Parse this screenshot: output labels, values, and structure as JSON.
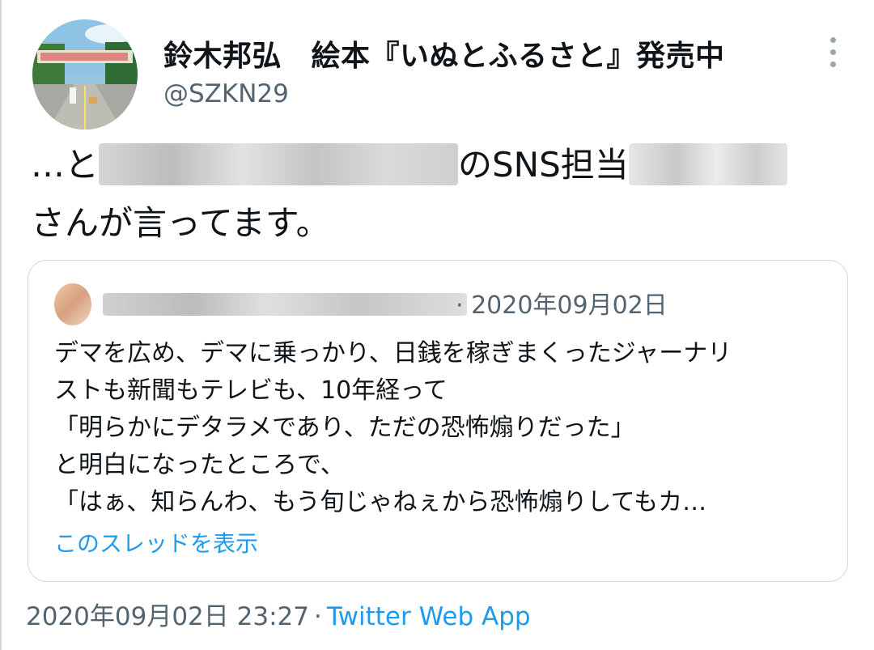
{
  "author": {
    "display_name": "鈴木邦弘　絵本『いぬとふるさと』発売中",
    "handle": "@SZKN29"
  },
  "tweet": {
    "line1_prefix": "…と",
    "line1_middle": "のSNS担当",
    "line2": "さんが言ってます。"
  },
  "quoted": {
    "date": "· 2020年09月02日",
    "lines": [
      "デマを広め、デマに乗っかり、日銭を稼ぎまくったジャーナリ",
      "ストも新聞もテレビも、10年経って",
      "「明らかにデタラメであり、ただの恐怖煽りだった」",
      "と明白になったところで、",
      "「はぁ、知らんわ、もう旬じゃねぇから恐怖煽りしてもカ…"
    ],
    "show_thread": "このスレッドを表示"
  },
  "footer": {
    "timestamp": "2020年09月02日 23:27",
    "separator": "·",
    "source": "Twitter Web App"
  },
  "colors": {
    "link": "#1d9bf0",
    "secondary_text": "#536471",
    "border": "#cfd9de"
  }
}
